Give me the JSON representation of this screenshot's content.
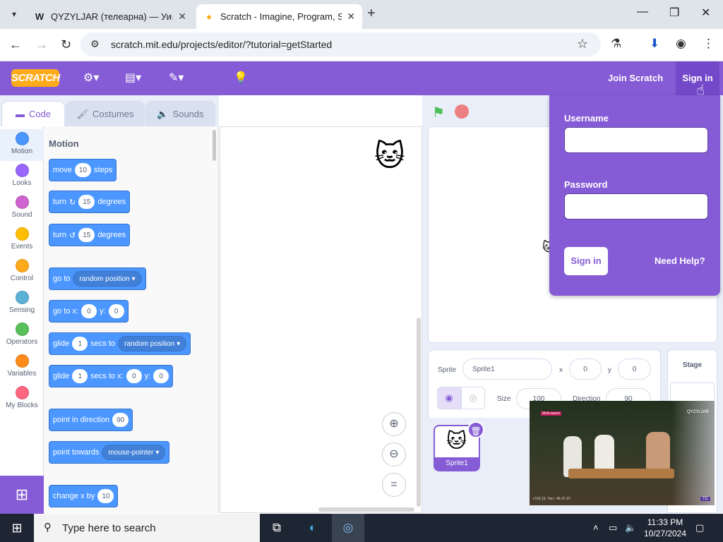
{
  "browser": {
    "tabs": [
      {
        "title": "QYZYLJAR (телеарна) — Уикип",
        "favicon": "W",
        "active": false
      },
      {
        "title": "Scratch - Imagine, Program, Sh",
        "favicon": "scratch-cat",
        "active": true
      }
    ],
    "url": "scratch.mit.edu/projects/editor/?tutorial=getStarted"
  },
  "menubar": {
    "logo_text": "SCRATCH",
    "join_label": "Join Scratch",
    "signin_label": "Sign in"
  },
  "editor_tabs": [
    "Code",
    "Costumes",
    "Sounds"
  ],
  "categories": [
    {
      "label": "Motion",
      "color": "#4c97ff"
    },
    {
      "label": "Looks",
      "color": "#9966ff"
    },
    {
      "label": "Sound",
      "color": "#cf63cf"
    },
    {
      "label": "Events",
      "color": "#ffbf00"
    },
    {
      "label": "Control",
      "color": "#ffab19"
    },
    {
      "label": "Sensing",
      "color": "#5cb1d6"
    },
    {
      "label": "Operators",
      "color": "#59c059"
    },
    {
      "label": "Variables",
      "color": "#ff8c1a"
    },
    {
      "label": "My Blocks",
      "color": "#ff6680"
    }
  ],
  "palette": {
    "title": "Motion",
    "blocks": {
      "move": {
        "a": "move",
        "v": "10",
        "b": "steps"
      },
      "turn_right": {
        "a": "turn",
        "v": "15",
        "b": "degrees"
      },
      "turn_left": {
        "a": "turn",
        "v": "15",
        "b": "degrees"
      },
      "goto": {
        "a": "go to",
        "d": "random position"
      },
      "goto_xy": {
        "a": "go to x:",
        "x": "0",
        "b": "y:",
        "y": "0"
      },
      "glide": {
        "a": "glide",
        "v": "1",
        "b": "secs to",
        "d": "random position"
      },
      "glide_xy": {
        "a": "glide",
        "v": "1",
        "b": "secs to x:",
        "x": "0",
        "c": "y:",
        "y": "0"
      },
      "point_dir": {
        "a": "point in direction",
        "v": "90"
      },
      "point_towards": {
        "a": "point towards",
        "d": "mouse-pointer"
      },
      "change_x": {
        "a": "change x by",
        "v": "10"
      }
    }
  },
  "sprite_info": {
    "sprite_label": "Sprite",
    "sprite_name": "Sprite1",
    "x_label": "x",
    "x_value": "0",
    "y_label": "y",
    "y_value": "0",
    "size_label": "Size",
    "size_value": "100",
    "direction_label": "Direction",
    "direction_value": "90"
  },
  "sprites": [
    {
      "name": "Sprite1"
    }
  ],
  "stage_pane": {
    "title": "Stage"
  },
  "signin_popup": {
    "username_label": "Username",
    "password_label": "Password",
    "username_value": "",
    "password_value": "",
    "submit_label": "Sign in",
    "help_label": "Need Help?"
  },
  "video_overlay": {
    "channel_badge": "Мой-канал",
    "corner_logo": "QYZYLJAR",
    "ticker": "+7(4) 15. Тел.: 46-37-37",
    "bottom_logo": "TC"
  },
  "taskbar": {
    "search_placeholder": "Type here to search",
    "time": "11:33 PM",
    "date": "10/27/2024"
  }
}
